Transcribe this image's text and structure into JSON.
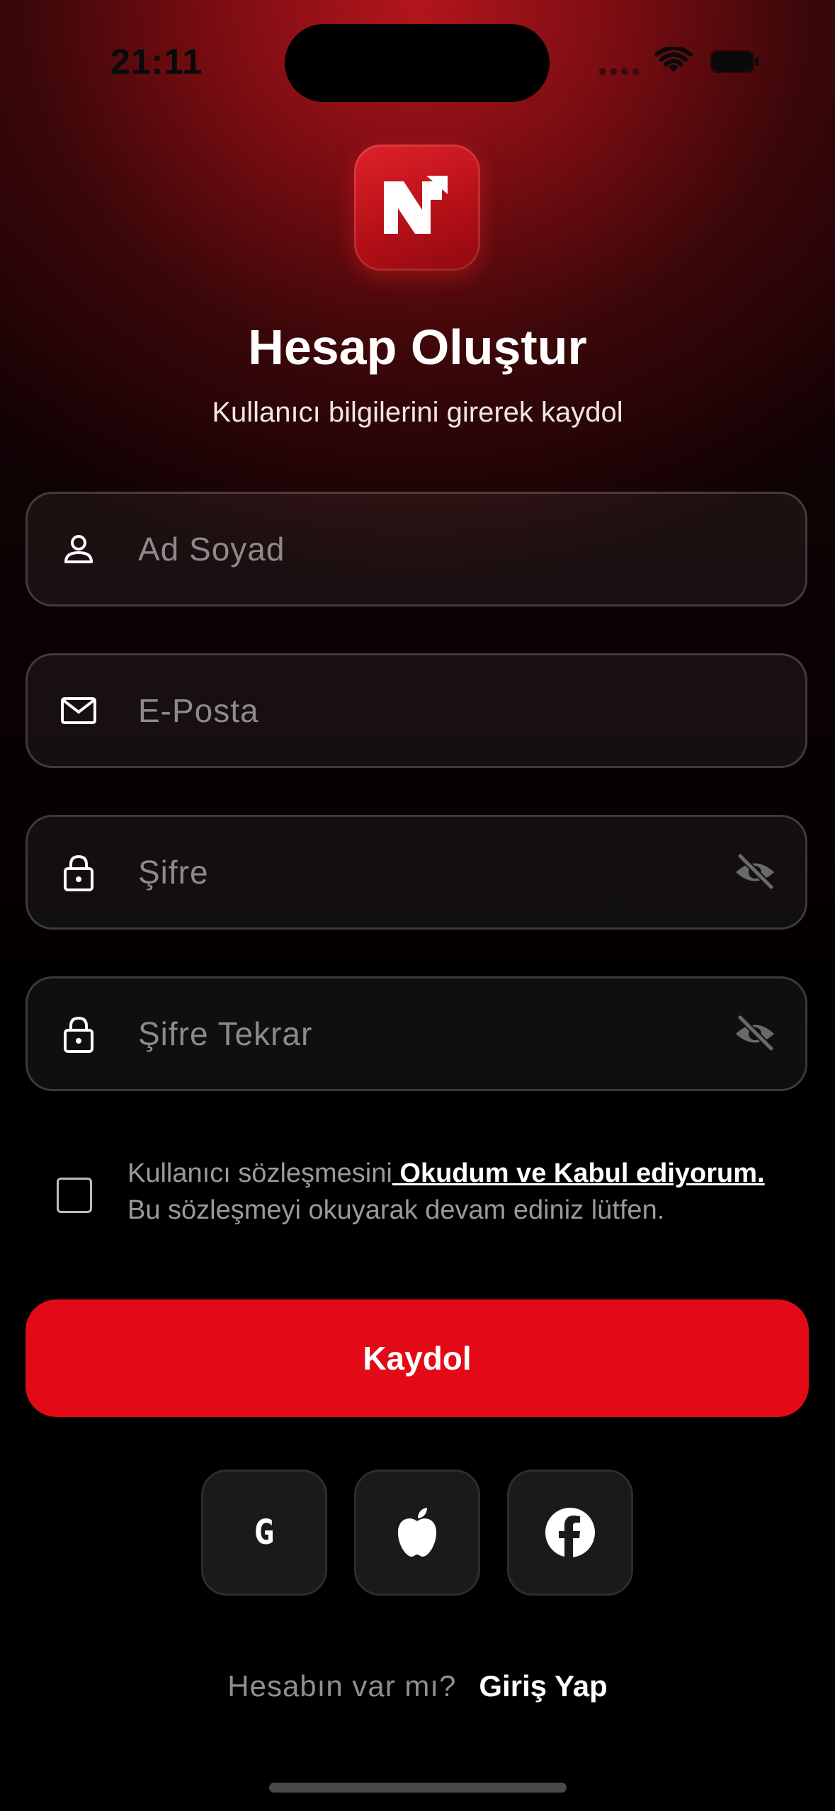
{
  "status_bar": {
    "time": "21:11"
  },
  "header": {
    "title": "Hesap Oluştur",
    "subtitle": "Kullanıcı bilgilerini girerek kaydol"
  },
  "form": {
    "name_placeholder": "Ad Soyad",
    "email_placeholder": "E-Posta",
    "password_placeholder": "Şifre",
    "password_repeat_placeholder": "Şifre Tekrar",
    "icons": {
      "name": "person-icon",
      "email": "mail-icon",
      "password": "lock-icon",
      "visibility": "eye-off-icon"
    }
  },
  "terms": {
    "prefix": "Kullanıcı sözleşmesini",
    "link": " Okudum ve Kabul ediyorum.",
    "note": "Bu sözleşmeyi okuyarak devam ediniz lütfen.",
    "checked": false
  },
  "actions": {
    "register_label": "Kaydol"
  },
  "social": {
    "google_letter": "G",
    "buttons": [
      "google-icon",
      "apple-icon",
      "facebook-icon"
    ]
  },
  "footer": {
    "question": "Hesabın var mı?",
    "login_label": "Giriş Yap"
  },
  "colors": {
    "accent": "#e20a16",
    "background": "#000000",
    "gradient_top": "#b3161c"
  }
}
